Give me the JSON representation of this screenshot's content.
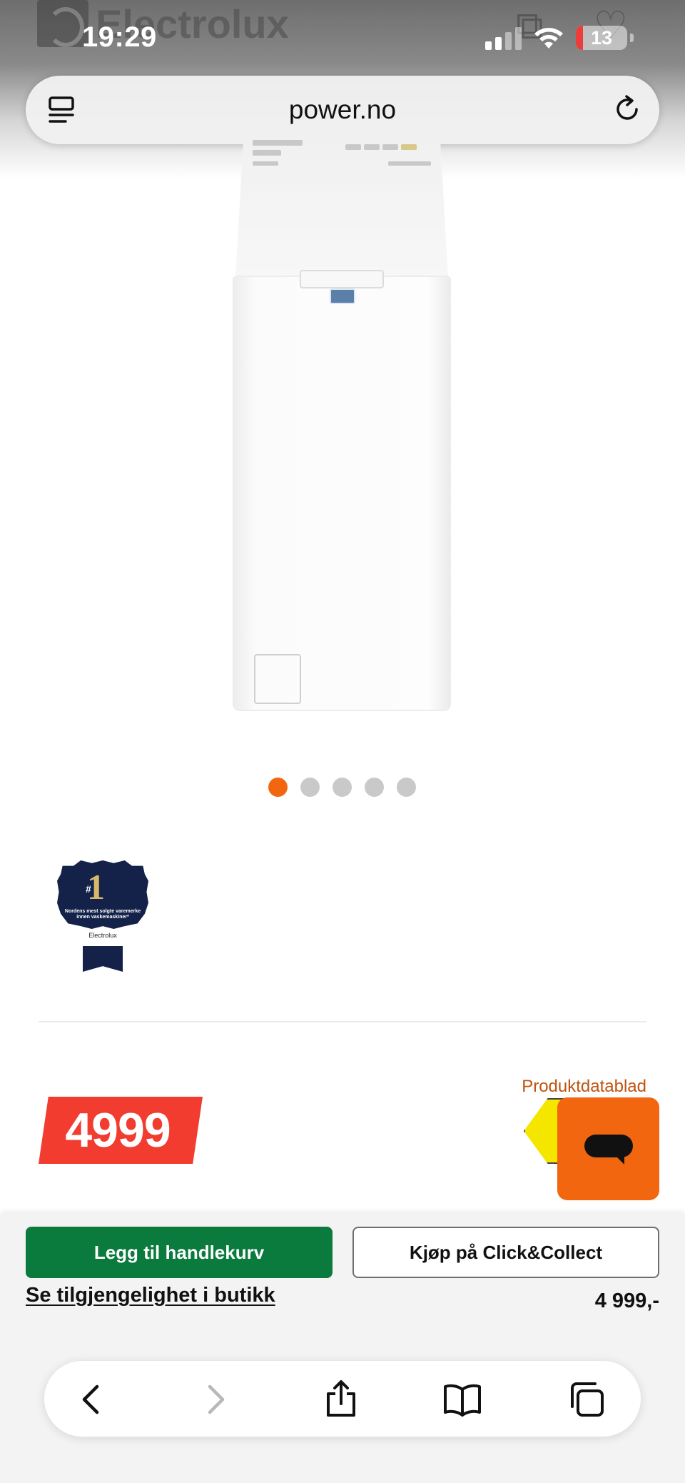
{
  "status_bar": {
    "time": "19:29",
    "battery_level": "13",
    "icons": [
      "cellular-signal-icon",
      "wifi-icon",
      "battery-icon"
    ]
  },
  "background_header": {
    "brand_text": "Electrolux",
    "icons": [
      "compare-icon",
      "wishlist-heart-icon"
    ]
  },
  "address_bar": {
    "url": "power.no",
    "icons": [
      "reader-mode-icon",
      "reload-icon"
    ]
  },
  "carousel": {
    "count": 5,
    "active_index": 0,
    "active_color": "#f1660f",
    "inactive_color": "#c9c9c9"
  },
  "award_badge": {
    "rank_hash": "#",
    "rank": "1",
    "text": "Nordens mest solgte varemerke innen vaskemaskiner*",
    "brand": "Electrolux"
  },
  "price": {
    "amount": "4999",
    "tag_color": "#f23c2f"
  },
  "datasheet_link": "Produktdatablad",
  "chat": {
    "icon": "chat-bubble-icon",
    "color": "#f1660f"
  },
  "action_sheet": {
    "add_to_cart": "Legg til handlekurv",
    "click_collect": "Kjøp på Click&Collect",
    "availability": "Se tilgjengelighet i butikk",
    "price": "4 999,-",
    "cart_color": "#0a7a3d"
  },
  "toolbar": {
    "icons": [
      "back-icon",
      "forward-icon",
      "share-icon",
      "bookmarks-icon",
      "tabs-icon"
    ]
  }
}
